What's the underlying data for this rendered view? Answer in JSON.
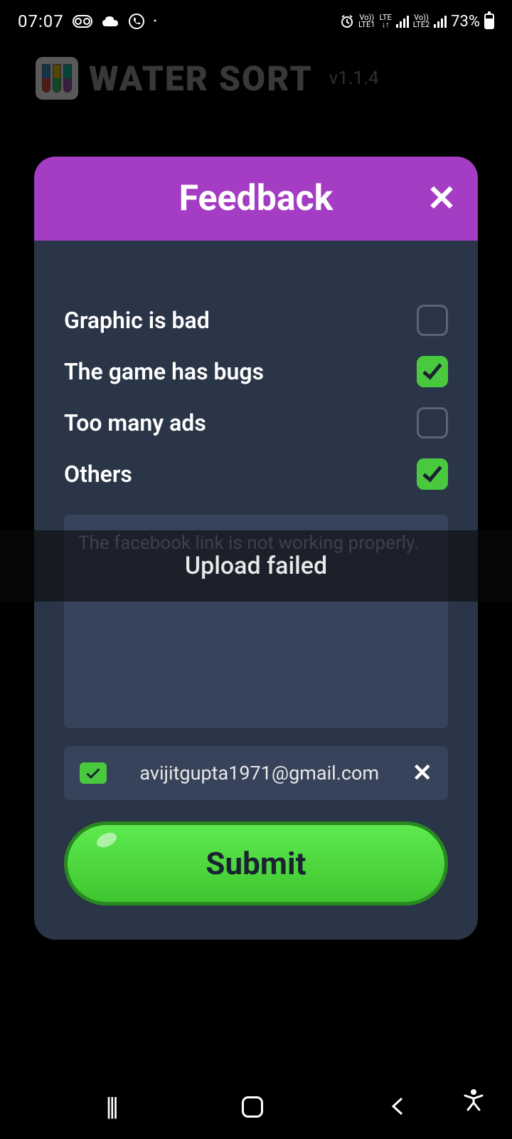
{
  "status_bar": {
    "time": "07:07",
    "battery": "73%",
    "lte1_label": "LTE1",
    "lte_label": "LTE",
    "lte2_label": "LTE2",
    "vo1": "Vo))",
    "vo2": "Vo))"
  },
  "background": {
    "app_title": "WATER SORT",
    "app_version": "v1.1.4"
  },
  "modal": {
    "title": "Feedback",
    "options": [
      {
        "label": "Graphic is bad",
        "checked": false
      },
      {
        "label": "The game has bugs",
        "checked": true
      },
      {
        "label": "Too many ads",
        "checked": false
      },
      {
        "label": "Others",
        "checked": true
      }
    ],
    "textarea_value": "The facebook link is not working properly.",
    "email": "avijitgupta1971@gmail.com",
    "submit_label": "Submit"
  },
  "toast": {
    "message": "Upload failed"
  }
}
